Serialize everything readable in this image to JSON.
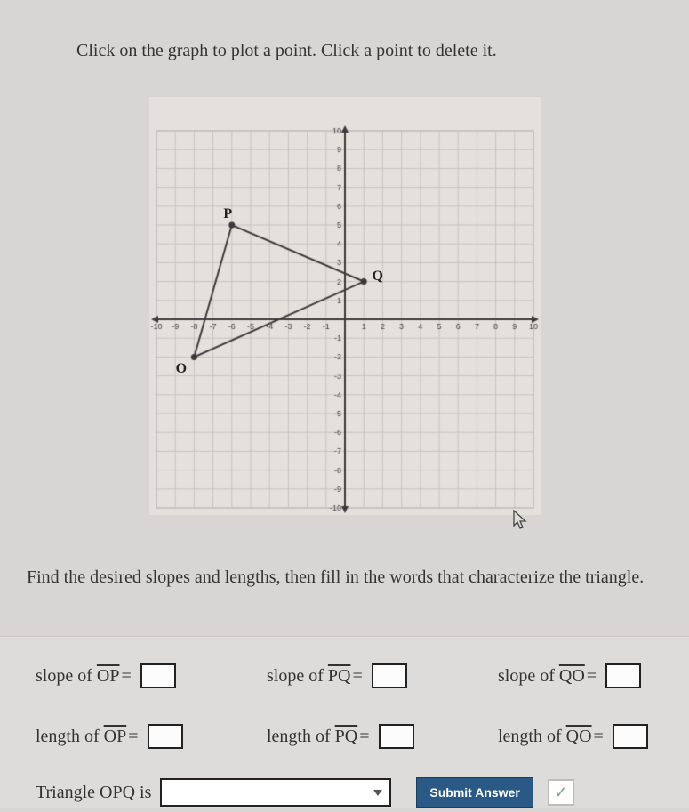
{
  "instruction": "Click on the graph to plot a point. Click a point to delete it.",
  "prompt": "Find the desired slopes and lengths, then fill in the words that characterize the triangle.",
  "labels": {
    "slope_OP": "slope of ",
    "slope_PQ": "slope of ",
    "slope_QO": "slope of ",
    "length_OP": "length of ",
    "length_PQ": "length of ",
    "length_QO": "length of ",
    "OP": "OP",
    "PQ": "PQ",
    "QO": "QO",
    "equals": "="
  },
  "triangle_prefix": "Triangle OPQ is",
  "submit": "Submit Answer",
  "check_glyph": "✓",
  "chart_data": {
    "type": "scatter",
    "title": "",
    "xlabel": "",
    "ylabel": "",
    "xlim": [
      -10,
      10
    ],
    "ylim": [
      -10,
      10
    ],
    "x_ticks": [
      -10,
      -9,
      -8,
      -7,
      -6,
      -5,
      -4,
      -3,
      -2,
      -1,
      1,
      2,
      3,
      4,
      5,
      6,
      7,
      8,
      9,
      10
    ],
    "y_ticks": [
      -10,
      -9,
      -8,
      -7,
      -6,
      -5,
      -4,
      -3,
      -2,
      -1,
      1,
      2,
      3,
      4,
      5,
      6,
      7,
      8,
      9,
      10
    ],
    "grid": true,
    "points": [
      {
        "name": "O",
        "x": -8,
        "y": -2
      },
      {
        "name": "P",
        "x": -6,
        "y": 5
      },
      {
        "name": "Q",
        "x": 1,
        "y": 2
      }
    ],
    "segments": [
      [
        "O",
        "P"
      ],
      [
        "P",
        "Q"
      ],
      [
        "Q",
        "O"
      ]
    ],
    "label_offsets": {
      "O": [
        -14,
        14
      ],
      "P": [
        -4,
        -12
      ],
      "Q": [
        16,
        -6
      ]
    }
  }
}
